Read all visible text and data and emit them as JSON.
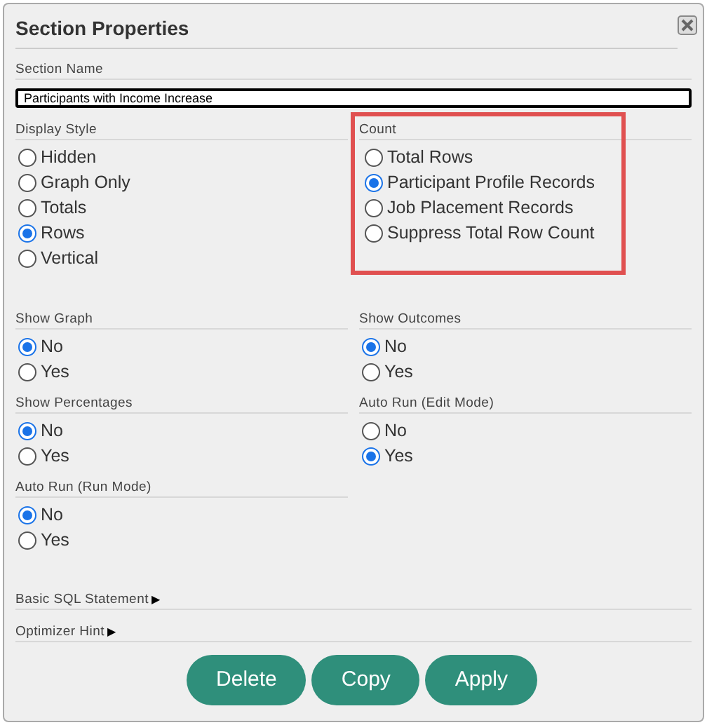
{
  "dialog": {
    "title": "Section Properties"
  },
  "section_name": {
    "label": "Section Name",
    "value": "Participants with Income Increase"
  },
  "rows": [
    [
      {
        "label": "Display Style",
        "highlighted": false,
        "options": [
          {
            "label": "Hidden",
            "selected": false
          },
          {
            "label": "Graph Only",
            "selected": false
          },
          {
            "label": "Totals",
            "selected": false
          },
          {
            "label": "Rows",
            "selected": true
          },
          {
            "label": "Vertical",
            "selected": false
          }
        ]
      },
      {
        "label": "Count",
        "highlighted": true,
        "options": [
          {
            "label": "Total Rows",
            "selected": false
          },
          {
            "label": "Participant Profile Records",
            "selected": true
          },
          {
            "label": "Job Placement Records",
            "selected": false
          },
          {
            "label": "Suppress Total Row Count",
            "selected": false
          }
        ]
      }
    ],
    [
      {
        "label": "Show Graph",
        "highlighted": false,
        "options": [
          {
            "label": "No",
            "selected": true
          },
          {
            "label": "Yes",
            "selected": false
          }
        ]
      },
      {
        "label": "Show Outcomes",
        "highlighted": false,
        "options": [
          {
            "label": "No",
            "selected": true
          },
          {
            "label": "Yes",
            "selected": false
          }
        ]
      }
    ],
    [
      {
        "label": "Show Percentages",
        "highlighted": false,
        "options": [
          {
            "label": "No",
            "selected": true
          },
          {
            "label": "Yes",
            "selected": false
          }
        ]
      },
      {
        "label": "Auto Run (Edit Mode)",
        "highlighted": false,
        "options": [
          {
            "label": "No",
            "selected": false
          },
          {
            "label": "Yes",
            "selected": true
          }
        ]
      }
    ],
    [
      {
        "label": "Auto Run (Run Mode)",
        "highlighted": false,
        "options": [
          {
            "label": "No",
            "selected": true
          },
          {
            "label": "Yes",
            "selected": false
          }
        ]
      }
    ]
  ],
  "collapsibles": [
    {
      "label": "Basic SQL Statement",
      "marker": "▶"
    },
    {
      "label": "Optimizer Hint",
      "marker": "▶"
    }
  ],
  "buttons": [
    "Delete",
    "Copy",
    "Apply"
  ]
}
